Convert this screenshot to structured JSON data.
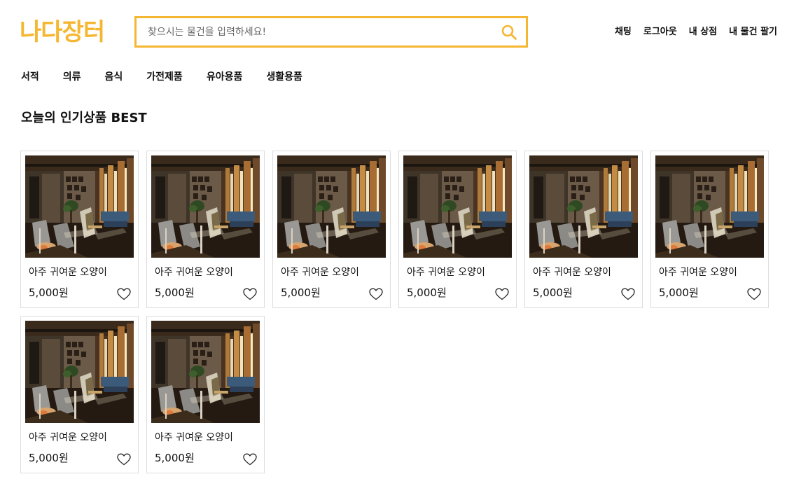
{
  "header": {
    "logo": "나다장터",
    "search_placeholder": "찾으시는 물건을 입력하세요!",
    "search_value": "",
    "nav": [
      {
        "label": "채팅"
      },
      {
        "label": "로그아웃"
      },
      {
        "label": "내 상점"
      },
      {
        "label": "내 물건 팔기"
      }
    ]
  },
  "categories": [
    {
      "label": "서적"
    },
    {
      "label": "의류"
    },
    {
      "label": "음식"
    },
    {
      "label": "가전제품"
    },
    {
      "label": "유아용품"
    },
    {
      "label": "생활용품"
    }
  ],
  "section": {
    "title": "오늘의 인기상품 BEST"
  },
  "products": [
    {
      "title": "아주 귀여운 오양이",
      "price": "5,000원"
    },
    {
      "title": "아주 귀여운 오양이",
      "price": "5,000원"
    },
    {
      "title": "아주 귀여운 오양이",
      "price": "5,000원"
    },
    {
      "title": "아주 귀여운 오양이",
      "price": "5,000원"
    },
    {
      "title": "아주 귀여운 오양이",
      "price": "5,000원"
    },
    {
      "title": "아주 귀여운 오양이",
      "price": "5,000원"
    },
    {
      "title": "아주 귀여운 오양이",
      "price": "5,000원"
    },
    {
      "title": "아주 귀여운 오양이",
      "price": "5,000원"
    }
  ],
  "colors": {
    "brand": "#f5b731",
    "border": "#dddddd",
    "text": "#111111"
  },
  "icons": {
    "search": "search-icon",
    "like": "heart-icon",
    "product_image": "interior-room-photo"
  }
}
